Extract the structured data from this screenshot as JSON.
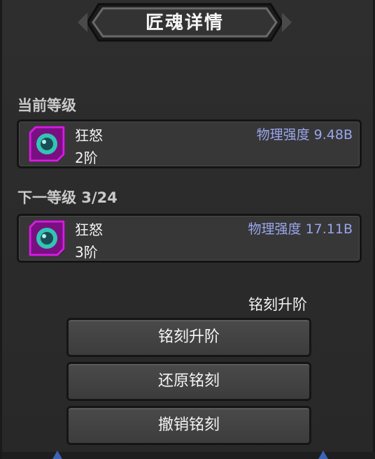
{
  "title": "匠魂详情",
  "current_level": {
    "section_label": "当前等级",
    "name": "狂怒",
    "rank": "2阶",
    "stat": "物理强度 9.48B"
  },
  "next_level": {
    "section_label": "下一等级 3/24",
    "name": "狂怒",
    "rank": "3阶",
    "stat": "物理强度 17.11B"
  },
  "action_label": "铭刻升阶",
  "buttons": {
    "upgrade": "铭刻升阶",
    "restore": "还原铭刻",
    "undo": "撤销铭刻"
  },
  "colors": {
    "stat_text": "#9aa6ec",
    "icon_frame": "#d51ee0",
    "icon_eye": "#33c4b4"
  },
  "icons": [
    "soul-eye-icon"
  ]
}
